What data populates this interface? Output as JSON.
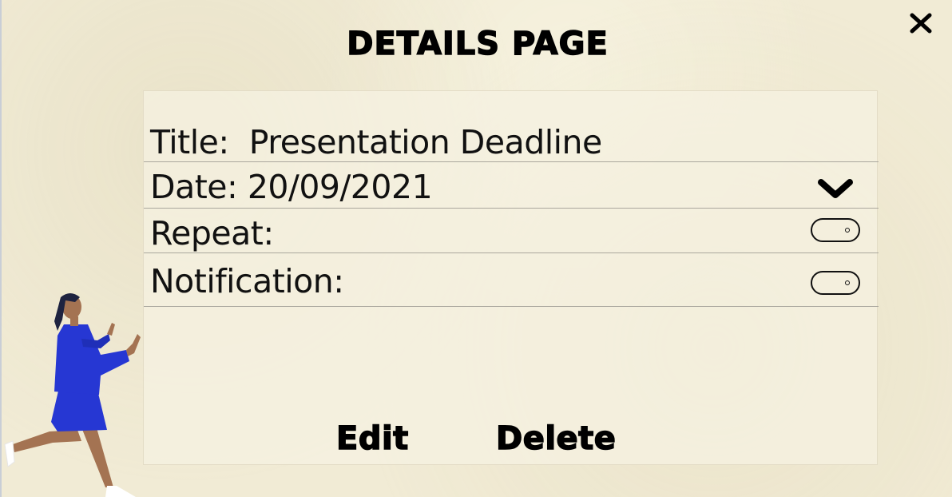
{
  "header": {
    "title": "DETAILS PAGE",
    "close_icon": "close-icon"
  },
  "details": {
    "title_row": "Title:  Presentation Deadline",
    "date_row": "Date: 20/09/2021",
    "date_dropdown_icon": "chevron-down-icon",
    "repeat_row": "Repeat:",
    "repeat_toggle": {
      "on": false
    },
    "notification_row": "Notification:",
    "notification_toggle": {
      "on": false
    }
  },
  "actions": {
    "edit_label": "Edit",
    "delete_label": "Delete"
  },
  "colors": {
    "background": "#f1ebd5",
    "text": "#111111",
    "divider": "#aaa79d",
    "illustration_blue": "#2637d3",
    "illustration_skin": "#a47352"
  }
}
